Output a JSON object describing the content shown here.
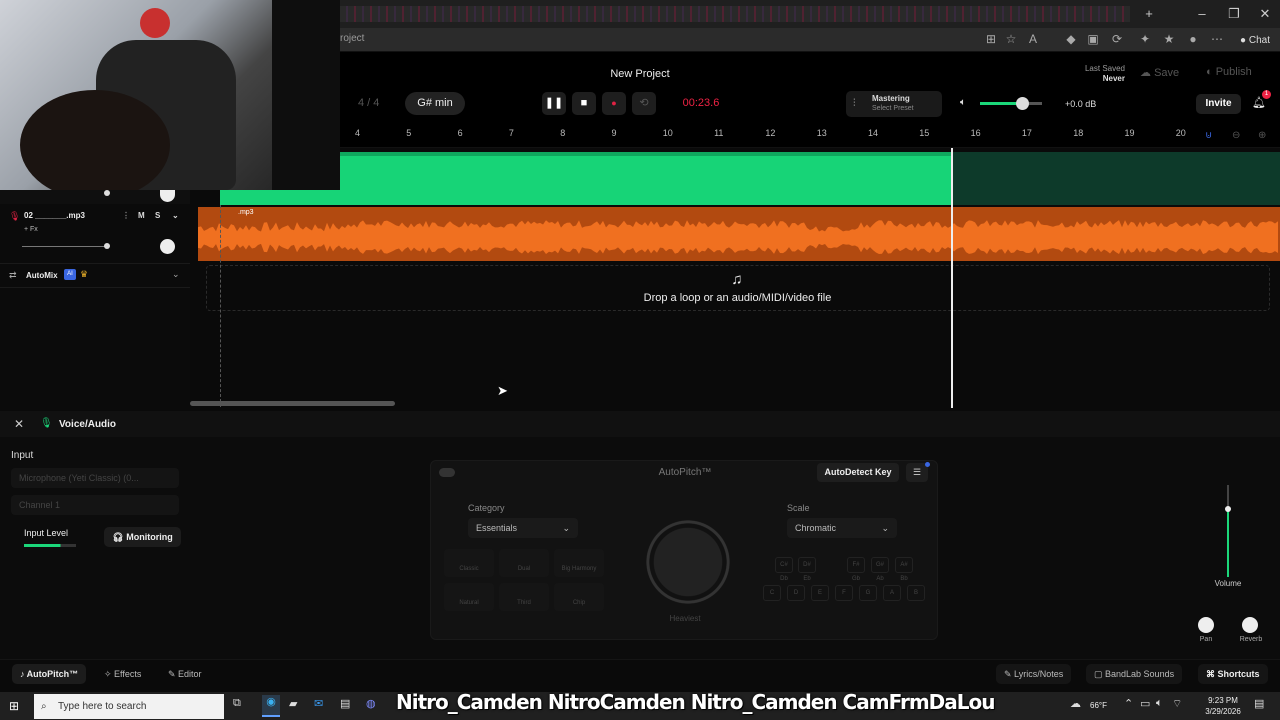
{
  "browser": {
    "url_fragment": "roject",
    "chat_label": "Chat"
  },
  "header": {
    "project_title": "New Project",
    "last_saved_label": "Last Saved",
    "last_saved_value": "Never",
    "save_label": "Save",
    "publish_label": "Publish",
    "time_signature": "4 / 4",
    "key": "G# min",
    "time": "00:23.6",
    "mastering_title": "Mastering",
    "mastering_sub": "Select Preset",
    "gain": "+0.0 dB",
    "invite_label": "Invite",
    "notification_count": "1"
  },
  "ruler": {
    "bars": [
      "4",
      "5",
      "6",
      "7",
      "8",
      "9",
      "10",
      "11",
      "12",
      "13",
      "14",
      "15",
      "16",
      "17",
      "18",
      "19",
      "20"
    ]
  },
  "tracks": {
    "track2_name": "02 _______.mp3",
    "mute": "M",
    "solo": "S",
    "fx": "+ Fx",
    "clip_label": ".mp3",
    "automix_label": "AutoMix",
    "ai_badge": "AI",
    "drop_text": "Drop a loop or an audio/MIDI/video file"
  },
  "panel": {
    "title": "Voice/Audio",
    "input_label": "Input",
    "input_device": "Microphone (Yeti Classic) (0...",
    "channel": "Channel 1",
    "input_level_label": "Input Level",
    "monitoring_label": "Monitoring",
    "autopitch": {
      "title": "AutoPitch™",
      "autodetect_label": "AutoDetect Key",
      "category_label": "Category",
      "category_value": "Essentials",
      "scale_label": "Scale",
      "scale_value": "Chromatic",
      "dial_label": "Heaviest",
      "presets": [
        "Classic",
        "Dual",
        "Big Harmony",
        "Natural",
        "Third",
        "Chip"
      ],
      "keys_top": [
        "C#\nDb",
        "D#\nEb",
        "F#\nGb",
        "G#\nAb",
        "A#\nBb"
      ],
      "keys_bottom": [
        "C",
        "D",
        "E",
        "F",
        "G",
        "A",
        "B"
      ]
    },
    "volume_label": "Volume",
    "pan_label": "Pan",
    "reverb_label": "Reverb"
  },
  "bottom_tabs": {
    "autopitch": "AutoPitch™",
    "effects": "Effects",
    "editor": "Editor",
    "lyrics": "Lyrics/Notes",
    "sounds": "BandLab Sounds",
    "shortcuts": "Shortcuts"
  },
  "taskbar": {
    "search_placeholder": "Type here to search",
    "social_text": "Nitro_Camden  NitroCamden  Nitro_Camden  CamFrmDaLou",
    "temperature": "66°F",
    "time": "9:23 PM",
    "date": "3/29/2026"
  },
  "colors": {
    "green_clip": "#17d477",
    "orange_clip": "#f07020",
    "accent_red": "#e22244",
    "ai_blue": "#3a66e0"
  }
}
